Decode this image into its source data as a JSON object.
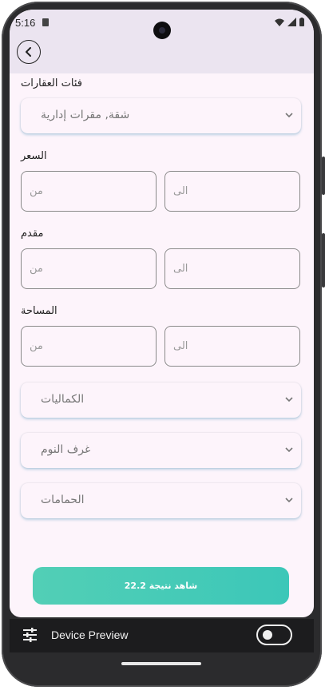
{
  "status_bar": {
    "time": "5:16"
  },
  "header": {
    "back_icon": "chevron-left-icon"
  },
  "filters": {
    "property_categories": {
      "label": "فئات العقارات",
      "value": "شقة, مقرات إدارية"
    },
    "price": {
      "label": "السعر",
      "to_placeholder": "الى",
      "from_placeholder": "من"
    },
    "down_payment": {
      "label": "مقدم",
      "to_placeholder": "الى",
      "from_placeholder": "من"
    },
    "area": {
      "label": "المساحة",
      "to_placeholder": "الى",
      "from_placeholder": "من"
    },
    "amenities": {
      "value": "الكماليات"
    },
    "bedrooms": {
      "value": "غرف النوم"
    },
    "bathrooms": {
      "value": "الحمامات"
    }
  },
  "submit": {
    "label": "شاهد نتيجة 22.2"
  },
  "device_preview": {
    "label": "Device Preview",
    "icon": "sliders-icon",
    "toggle_on": false
  },
  "colors": {
    "accent": "#3cc7b8",
    "header_bg": "#ebe4f0",
    "screen_bg": "#fdf4fb",
    "bar_bg": "#1c1c1e"
  }
}
